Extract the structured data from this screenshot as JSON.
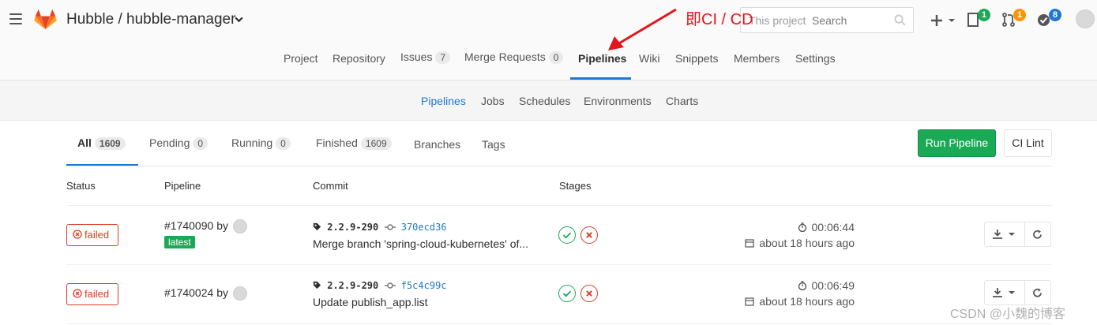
{
  "header": {
    "project_title": "Hubble / hubble-manager",
    "annotation": "即CI / CD",
    "search_prefix": "This project",
    "search_placeholder": "Search",
    "todos_count": "1",
    "merge_requests_count": "1",
    "issues_count": "8"
  },
  "project_nav": [
    {
      "label": "Project"
    },
    {
      "label": "Repository"
    },
    {
      "label": "Issues",
      "count": "7"
    },
    {
      "label": "Merge Requests",
      "count": "0"
    },
    {
      "label": "Pipelines",
      "active": true
    },
    {
      "label": "Wiki"
    },
    {
      "label": "Snippets"
    },
    {
      "label": "Members"
    },
    {
      "label": "Settings"
    }
  ],
  "sub_nav": [
    {
      "label": "Pipelines",
      "active": true
    },
    {
      "label": "Jobs"
    },
    {
      "label": "Schedules"
    },
    {
      "label": "Environments"
    },
    {
      "label": "Charts"
    }
  ],
  "scope_tabs": [
    {
      "label": "All",
      "count": "1609",
      "active": true
    },
    {
      "label": "Pending",
      "count": "0"
    },
    {
      "label": "Running",
      "count": "0"
    },
    {
      "label": "Finished",
      "count": "1609"
    },
    {
      "label": "Branches"
    },
    {
      "label": "Tags"
    }
  ],
  "buttons": {
    "run_pipeline": "Run Pipeline",
    "ci_lint": "CI Lint"
  },
  "table": {
    "headers": [
      "Status",
      "Pipeline",
      "Commit",
      "Stages"
    ],
    "rows": [
      {
        "status": "failed",
        "pipeline_id": "#1740090",
        "by": "by",
        "tag": "latest",
        "ref": "2.2.9-290",
        "sha": "370ecd36",
        "message": "Merge branch 'spring-cloud-kubernetes' of...",
        "duration": "00:06:44",
        "finished": "about 18 hours ago"
      },
      {
        "status": "failed",
        "pipeline_id": "#1740024",
        "by": "by",
        "ref": "2.2.9-290",
        "sha": "f5c4c99c",
        "message": "Update publish_app.list",
        "duration": "00:06:49",
        "finished": "about 18 hours ago"
      }
    ]
  },
  "watermark": "CSDN @小魏的博客",
  "colors": {
    "accent": "#1f78d1",
    "success": "#1aaa55",
    "danger": "#db3b21",
    "annotation": "#e4141b"
  }
}
